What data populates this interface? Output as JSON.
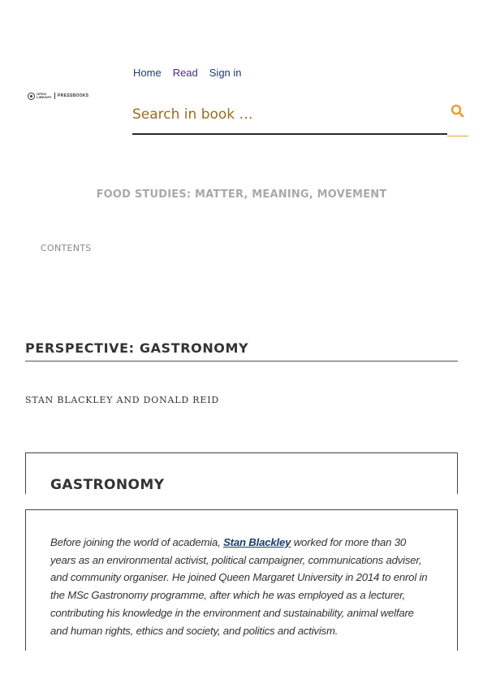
{
  "logo": {
    "line1": "OPEN",
    "line2": "LIBRARY",
    "brand": "PRESSBOOKS"
  },
  "nav": {
    "home": "Home",
    "read": "Read",
    "signin": "Sign in"
  },
  "search": {
    "placeholder": "Search in book …",
    "icon": "search-icon"
  },
  "book_title": "FOOD STUDIES: MATTER, MEANING, MOVEMENT",
  "contents_label": "CONTENTS",
  "chapter": {
    "title": "PERSPECTIVE: GASTRONOMY",
    "authors": "STAN BLACKLEY AND DONALD REID"
  },
  "section": {
    "heading": "GASTRONOMY",
    "bio_before": "Before joining the world of academia, ",
    "bio_link": "Stan Blackley",
    "bio_after": " worked for more than 30 years as an environmental activist, political campaigner, communications adviser, and community organiser. He joined Queen Margaret University in 2014 to enrol in the MSc Gastronomy programme, after which he was employed as a lecturer, contributing his knowledge in the environment and sustainability, animal welfare and human rights, ethics and society, and politics and activism."
  },
  "colors": {
    "accent": "#e6a23c",
    "search_text": "#9a6b1e",
    "link": "#1c3d6e",
    "read_link": "#4a2b8c",
    "muted": "#a9a9a9"
  }
}
